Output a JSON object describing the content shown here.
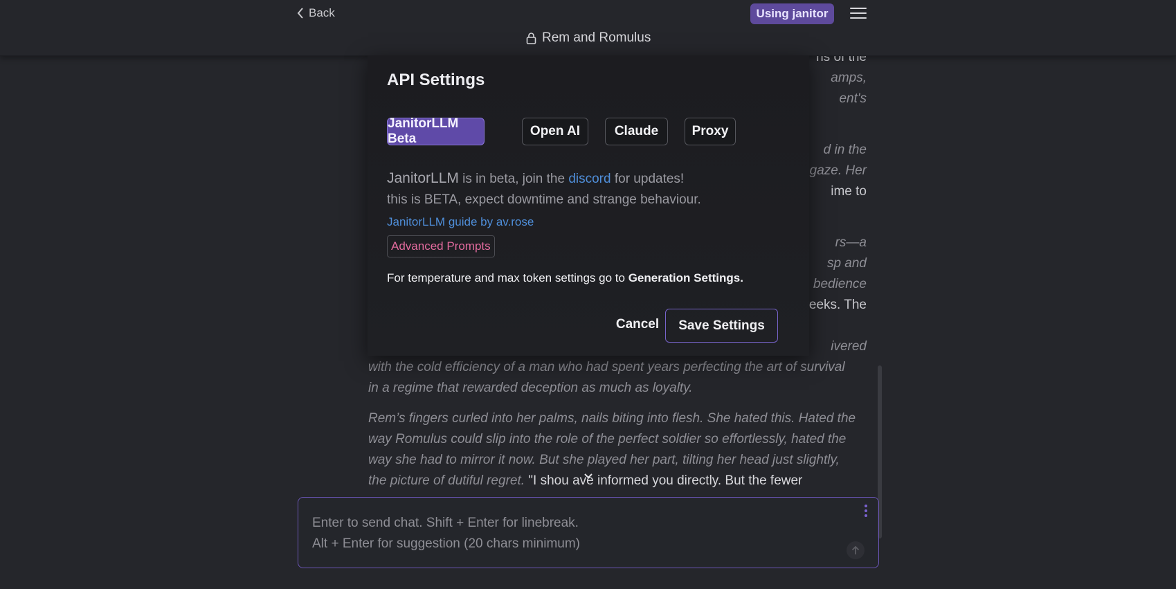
{
  "header": {
    "back_label": "Back",
    "using_badge": "Using janitor",
    "chat_title": "Rem and Romulus"
  },
  "chat_fragments": {
    "f1": "ns of the",
    "f2": "amps,",
    "f3": "ent's",
    "f4": "d in the",
    "f5": "gaze. Her",
    "f6": "ime to",
    "f7": "rs—a",
    "f8": "sp and",
    "f9": "bedience",
    "f10": "eeks. The",
    "f11": "ivered",
    "p1_line1": "with the cold efficiency of a man who had spent years perfecting the art of survival",
    "p1_line2": "in a regime that rewarded deception as much as loyalty.",
    "p2_line1": "Rem’s fingers curled into her palms, nails biting into flesh. She hated this. Hated the",
    "p2_line2": "way Romulus could slip into the role of the perfect soldier so effortlessly, hated the",
    "p2_line3": "way she had to mirror it now. But she played her part, tilting her head just slightly,",
    "p2_line4_italic": "the picture of dutiful regret.",
    "p2_line4_quote": "\"I shou    ave informed you directly. But the fewer"
  },
  "composer": {
    "placeholder_line1": "Enter to send chat. Shift + Enter for linebreak.",
    "placeholder_line2": "Alt + Enter for suggestion (20 chars minimum)"
  },
  "modal": {
    "title": "API Settings",
    "tabs": [
      {
        "label": "JanitorLLM Beta",
        "active": true
      },
      {
        "label": "Open AI",
        "active": false
      },
      {
        "label": "Claude",
        "active": false
      },
      {
        "label": "Proxy",
        "active": false
      }
    ],
    "info_brand": "JanitorLLM",
    "info_mid": " is in beta, join the ",
    "info_link": "discord",
    "info_end": " for updates!",
    "beta_warning": "this is BETA, expect downtime and strange behaviour.",
    "guide_link": "JanitorLLM guide by av.rose",
    "advanced_prompts": "Advanced Prompts",
    "gen_prefix": "For temperature and max token settings go to ",
    "gen_bold": "Generation Settings.",
    "cancel_label": "Cancel",
    "save_label": "Save Settings"
  },
  "colors": {
    "background": "#25262b",
    "accent": "#5f4aa8",
    "link": "#4f8ed9",
    "advanced_prompts": "#e46b9e"
  }
}
